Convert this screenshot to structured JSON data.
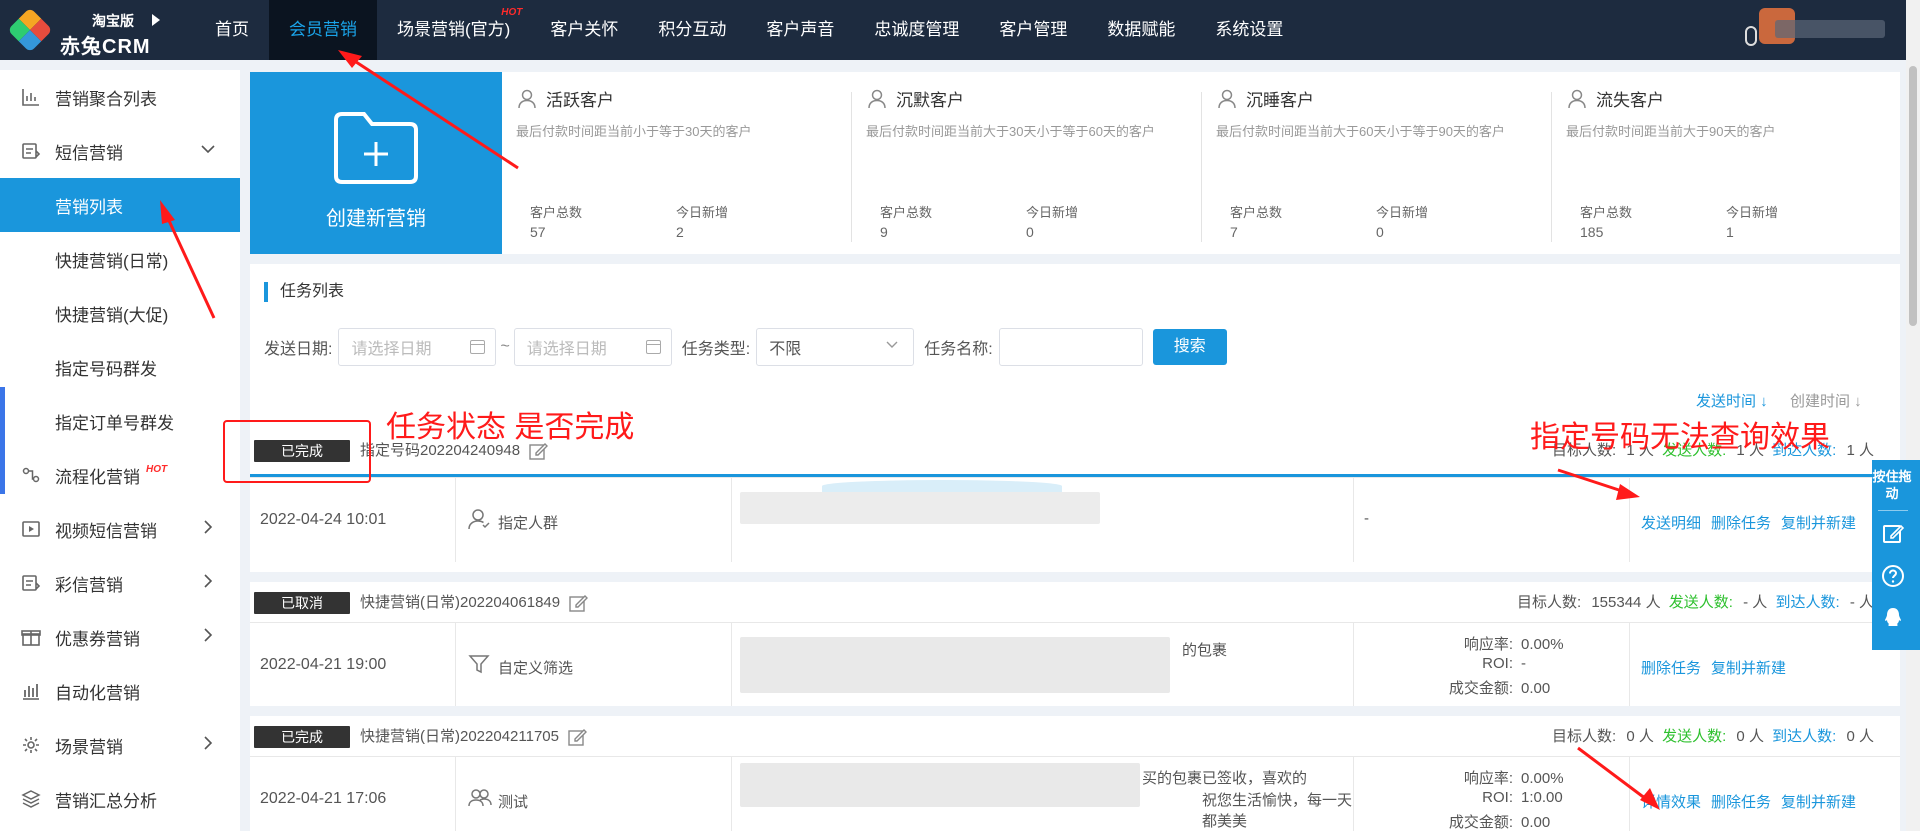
{
  "app": {
    "edition": "淘宝版",
    "name": "赤兔CRM"
  },
  "nav": {
    "items": [
      {
        "label": "首页",
        "active": false
      },
      {
        "label": "会员营销",
        "active": true
      },
      {
        "label": "场景营销(官方)",
        "active": false,
        "hot": "HOT"
      },
      {
        "label": "客户关怀",
        "active": false
      },
      {
        "label": "积分互动",
        "active": false
      },
      {
        "label": "客户声音",
        "active": false
      },
      {
        "label": "忠诚度管理",
        "active": false
      },
      {
        "label": "客户管理",
        "active": false
      },
      {
        "label": "数据赋能",
        "active": false
      },
      {
        "label": "系统设置",
        "active": false
      }
    ]
  },
  "sidebar": {
    "items": [
      {
        "label": "营销聚合列表",
        "icon": "chart-icon"
      },
      {
        "label": "短信营销",
        "icon": "sms-icon",
        "expanded": true
      },
      {
        "label": "营销列表",
        "sub": true,
        "active": true
      },
      {
        "label": "快捷营销(日常)",
        "sub": true
      },
      {
        "label": "快捷营销(大促)",
        "sub": true
      },
      {
        "label": "指定号码群发",
        "sub": true
      },
      {
        "label": "指定订单号群发",
        "sub": true
      },
      {
        "label": "流程化营销",
        "icon": "flow-icon",
        "hot": "HOT"
      },
      {
        "label": "视频短信营销",
        "icon": "video-icon",
        "has_arrow": true
      },
      {
        "label": "彩信营销",
        "icon": "mms-icon",
        "has_arrow": true
      },
      {
        "label": "优惠券营销",
        "icon": "gift-icon",
        "has_arrow": true
      },
      {
        "label": "自动化营销",
        "icon": "auto-icon"
      },
      {
        "label": "场景营销",
        "icon": "scene-icon",
        "has_arrow": true
      },
      {
        "label": "营销汇总分析",
        "icon": "layers-icon"
      }
    ]
  },
  "create": {
    "label": "创建新营销"
  },
  "segments": [
    {
      "name": "活跃客户",
      "desc": "最后付款时间距当前小于等于30天的客户",
      "total_label": "客户总数",
      "total": "57",
      "new_label": "今日新增",
      "new": "2"
    },
    {
      "name": "沉默客户",
      "desc": "最后付款时间距当前大于30天小于等于60天的客户",
      "total_label": "客户总数",
      "total": "9",
      "new_label": "今日新增",
      "new": "0"
    },
    {
      "name": "沉睡客户",
      "desc": "最后付款时间距当前大于60天小于等于90天的客户",
      "total_label": "客户总数",
      "total": "7",
      "new_label": "今日新增",
      "new": "0"
    },
    {
      "name": "流失客户",
      "desc": "最后付款时间距当前大于90天的客户",
      "total_label": "客户总数",
      "total": "185",
      "new_label": "今日新增",
      "new": "1"
    }
  ],
  "tasks_panel": {
    "title": "任务列表",
    "filters": {
      "send_date_label": "发送日期:",
      "date_placeholder_start": "请选择日期",
      "date_sep": "~",
      "date_placeholder_end": "请选择日期",
      "type_label": "任务类型:",
      "type_value": "不限",
      "name_label": "任务名称:",
      "name_value": "",
      "search_label": "搜索"
    },
    "sort": {
      "send_time": "发送时间",
      "create_time": "创建时间"
    },
    "count_labels": {
      "target": "目标人数:",
      "sent": "发送人数:",
      "reached": "到达人数:",
      "unit": "人"
    },
    "stat_labels": {
      "response": "响应率:",
      "roi": "ROI:",
      "amount": "成交金额:"
    },
    "tasks": [
      {
        "status": "已完成",
        "name": "指定号码202204240948",
        "target": "1",
        "sent": "1",
        "reached": "1",
        "date": "2022-04-24 10:01",
        "type": "指定人群",
        "type_icon": "person-icon",
        "content_visible": "",
        "stats_text": "-",
        "ops": [
          "发送明细",
          "删除任务",
          "复制并新建"
        ]
      },
      {
        "status": "已取消",
        "name": "快捷营销(日常)202204061849",
        "target": "155344",
        "sent": "-",
        "reached": "-",
        "date": "2022-04-21 19:00",
        "type": "自定义筛选",
        "type_icon": "filter-icon",
        "content_visible": "的包裹",
        "response": "0.00%",
        "roi": "-",
        "amount": "0.00",
        "ops": [
          "删除任务",
          "复制并新建"
        ]
      },
      {
        "status": "已完成",
        "name": "快捷营销(日常)202204211705",
        "target": "0",
        "sent": "0",
        "reached": "0",
        "date": "2022-04-21 17:06",
        "type": "测试",
        "type_icon": "group-icon",
        "content_visible": "买的包裹已签收，喜欢的",
        "content_visible_2": "祝您生活愉快，每一天都美美",
        "response": "0.00%",
        "roi": "1:0.00",
        "amount": "0.00",
        "ops": [
          "详情效果",
          "删除任务",
          "复制并新建"
        ]
      }
    ]
  },
  "float_bar": {
    "text": "按住拖动"
  },
  "annotations": {
    "status_note": "任务状态 是否完成",
    "query_note": "指定号码无法查询效果",
    "color": "#ff1a1a"
  },
  "colors": {
    "nav_bg": "#1d2b3f",
    "accent": "#1a96dc",
    "badge_bg": "#333333",
    "sent_green": "#2ec02e"
  }
}
